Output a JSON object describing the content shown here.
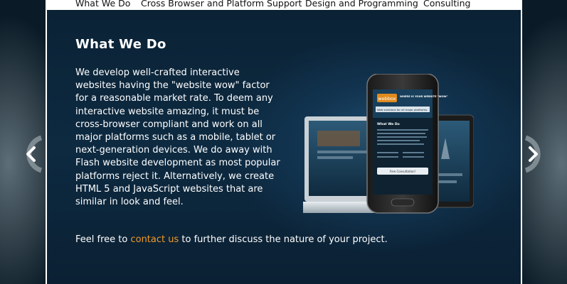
{
  "nav": {
    "items": [
      {
        "label": "What We Do"
      },
      {
        "label": "Cross Browser and Platform Support"
      },
      {
        "label": "Design and Programming"
      },
      {
        "label": "Consulting"
      }
    ]
  },
  "main": {
    "title": "What We Do",
    "paragraph": "We develop well-crafted interactive websites having the \"website wow\" factor for a reasonable market rate. To deem any interactive website amazing, it must be cross-browser compliant and work on all major platforms such as a mobile, tablet or next-generation devices. We do away with Flash website development as most popular platforms reject it. Alternatively, we create HTML 5 and JavaScript websites that are similar in look and feel.",
    "cta_before": "Feel free to ",
    "cta_link": "contact us",
    "cta_after": " to further discuss the nature of your project."
  },
  "phone_screen": {
    "logo": "webbox",
    "tagline": "WHERE IS YOUR WEBSITE \"WOW\"",
    "subtitle": "Web solutions for all major platforms.",
    "section": "What We Do",
    "button": "Free Consultation!"
  },
  "colors": {
    "accent_link": "#f09a2a",
    "panel_bg": "#0d2a41",
    "nav_bg": "#ffffff"
  },
  "icons": {
    "prev": "chevron-left-icon",
    "next": "chevron-right-icon"
  }
}
